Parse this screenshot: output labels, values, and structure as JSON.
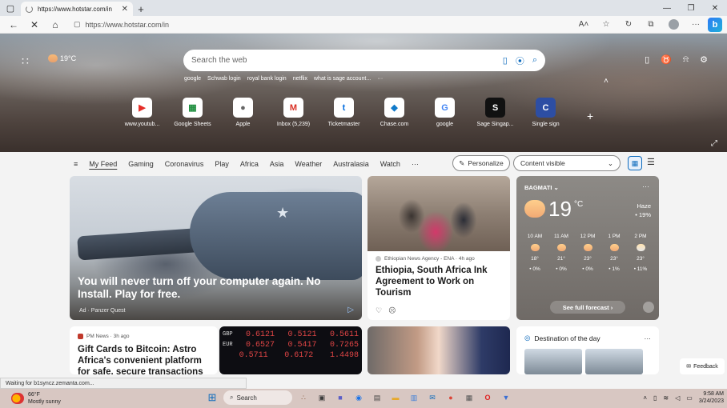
{
  "browser": {
    "tab_title": "https://www.hotstar.com/in",
    "url": "https://www.hotstar.com/in",
    "icons": [
      "tab-actions-icon",
      "refresh-loading-icon",
      "close-icon",
      "plus-icon",
      "back-arrow-icon",
      "stop-icon",
      "home-icon",
      "lock-icon",
      "read-aloud-icon",
      "favorite-star-icon",
      "extensions-icon",
      "collections-icon",
      "profile-avatar",
      "more-icon",
      "bing-icon"
    ],
    "read_aloud_label": "A˄",
    "more_label": "···"
  },
  "hero": {
    "weather_temp": "19°C",
    "search_placeholder": "Search the web",
    "quick_searches": [
      "google",
      "Schwab login",
      "royal bank login",
      "netflix",
      "what is sage account...",
      "···"
    ],
    "tiles": [
      {
        "label": "www.youtub...",
        "glyph": "▶",
        "color": "#e52d27"
      },
      {
        "label": "Google Sheets",
        "glyph": "▦",
        "color": "#1e8e3e"
      },
      {
        "label": "Apple",
        "glyph": "",
        "color": "#666666"
      },
      {
        "label": "Inbox (5,239)",
        "glyph": "M",
        "color": "#d93025"
      },
      {
        "label": "Ticketmaster",
        "glyph": "t",
        "color": "#026cdf"
      },
      {
        "label": "Chase.com",
        "glyph": "◆",
        "color": "#117aca"
      },
      {
        "label": "google",
        "glyph": "G",
        "color": "#4285f4"
      },
      {
        "label": "Sage Singap...",
        "glyph": "S",
        "color": "#111111"
      },
      {
        "label": "Single sign",
        "glyph": "C",
        "color": "#2d4ea3"
      }
    ]
  },
  "feednav": {
    "items": [
      "My Feed",
      "Gaming",
      "Coronavirus",
      "Play",
      "Africa",
      "Asia",
      "Weather",
      "Australasia",
      "Watch",
      "···"
    ],
    "personalize_label": "Personalize",
    "content_visible_label": "Content visible"
  },
  "cards": {
    "hero_headline": "You will never turn off your computer again. No Install. Play for free.",
    "hero_ad": "Ad · Panzer Quest",
    "eth_source": "Ethiopian News Agency - ENA · 4h ago",
    "eth_title": "Ethiopia, South Africa Ink Agreement to Work on Tourism",
    "btc_source": "PM News · 3h ago",
    "btc_title": "Gift Cards to Bitcoin: Astro Africa's convenient platform for safe, secure transactions",
    "dest_title": "Destination of the day",
    "stocks": [
      {
        "label": "GBP",
        "v1": "0.6121",
        "v2": "0.5121",
        "v3": "0.5611"
      },
      {
        "label": "EUR",
        "v1": "0.6527",
        "v2": "0.5417",
        "v3": "0.7265"
      },
      {
        "label": "",
        "v1": "0.5711",
        "v2": "0.6172",
        "v3": "1.4498"
      }
    ]
  },
  "weather": {
    "location": "BAGMATI",
    "temp": "19",
    "unit": "°C",
    "condition": "Haze",
    "precip": "• 19%",
    "hours": [
      {
        "time": "10 AM",
        "temp": "18°",
        "precip": "• 0%"
      },
      {
        "time": "11 AM",
        "temp": "21°",
        "precip": "• 0%"
      },
      {
        "time": "12 PM",
        "temp": "23°",
        "precip": "• 0%"
      },
      {
        "time": "1 PM",
        "temp": "23°",
        "precip": "• 1%"
      },
      {
        "time": "2 PM",
        "temp": "23°",
        "precip": "• 11%"
      }
    ],
    "forecast_label": "See full forecast ›"
  },
  "feedback_label": "Feedback",
  "status_text": "Waiting for b1syncz.zemanta.com...",
  "taskbar": {
    "weather_temp": "66°F",
    "weather_cond": "Mostly sunny",
    "search_label": "Search",
    "time": "9:58 AM",
    "date": "3/24/2023",
    "apps": [
      {
        "name": "task-view-icon",
        "glyph": "▣",
        "color": "#3a3a3a"
      },
      {
        "name": "edge-icon",
        "glyph": "◉",
        "color": "#1a73e8"
      },
      {
        "name": "store-icon",
        "glyph": "▥",
        "color": "#3b7dd8"
      },
      {
        "name": "chat-icon",
        "glyph": "■",
        "color": "#5b5fc7"
      },
      {
        "name": "mail-icon",
        "glyph": "✉",
        "color": "#0f6cbd"
      },
      {
        "name": "chrome-icon",
        "glyph": "●",
        "color": "#db4437"
      },
      {
        "name": "opera-icon",
        "glyph": "O",
        "color": "#e01e1e"
      },
      {
        "name": "shield-icon",
        "glyph": "▼",
        "color": "#3b6fd4"
      }
    ]
  }
}
